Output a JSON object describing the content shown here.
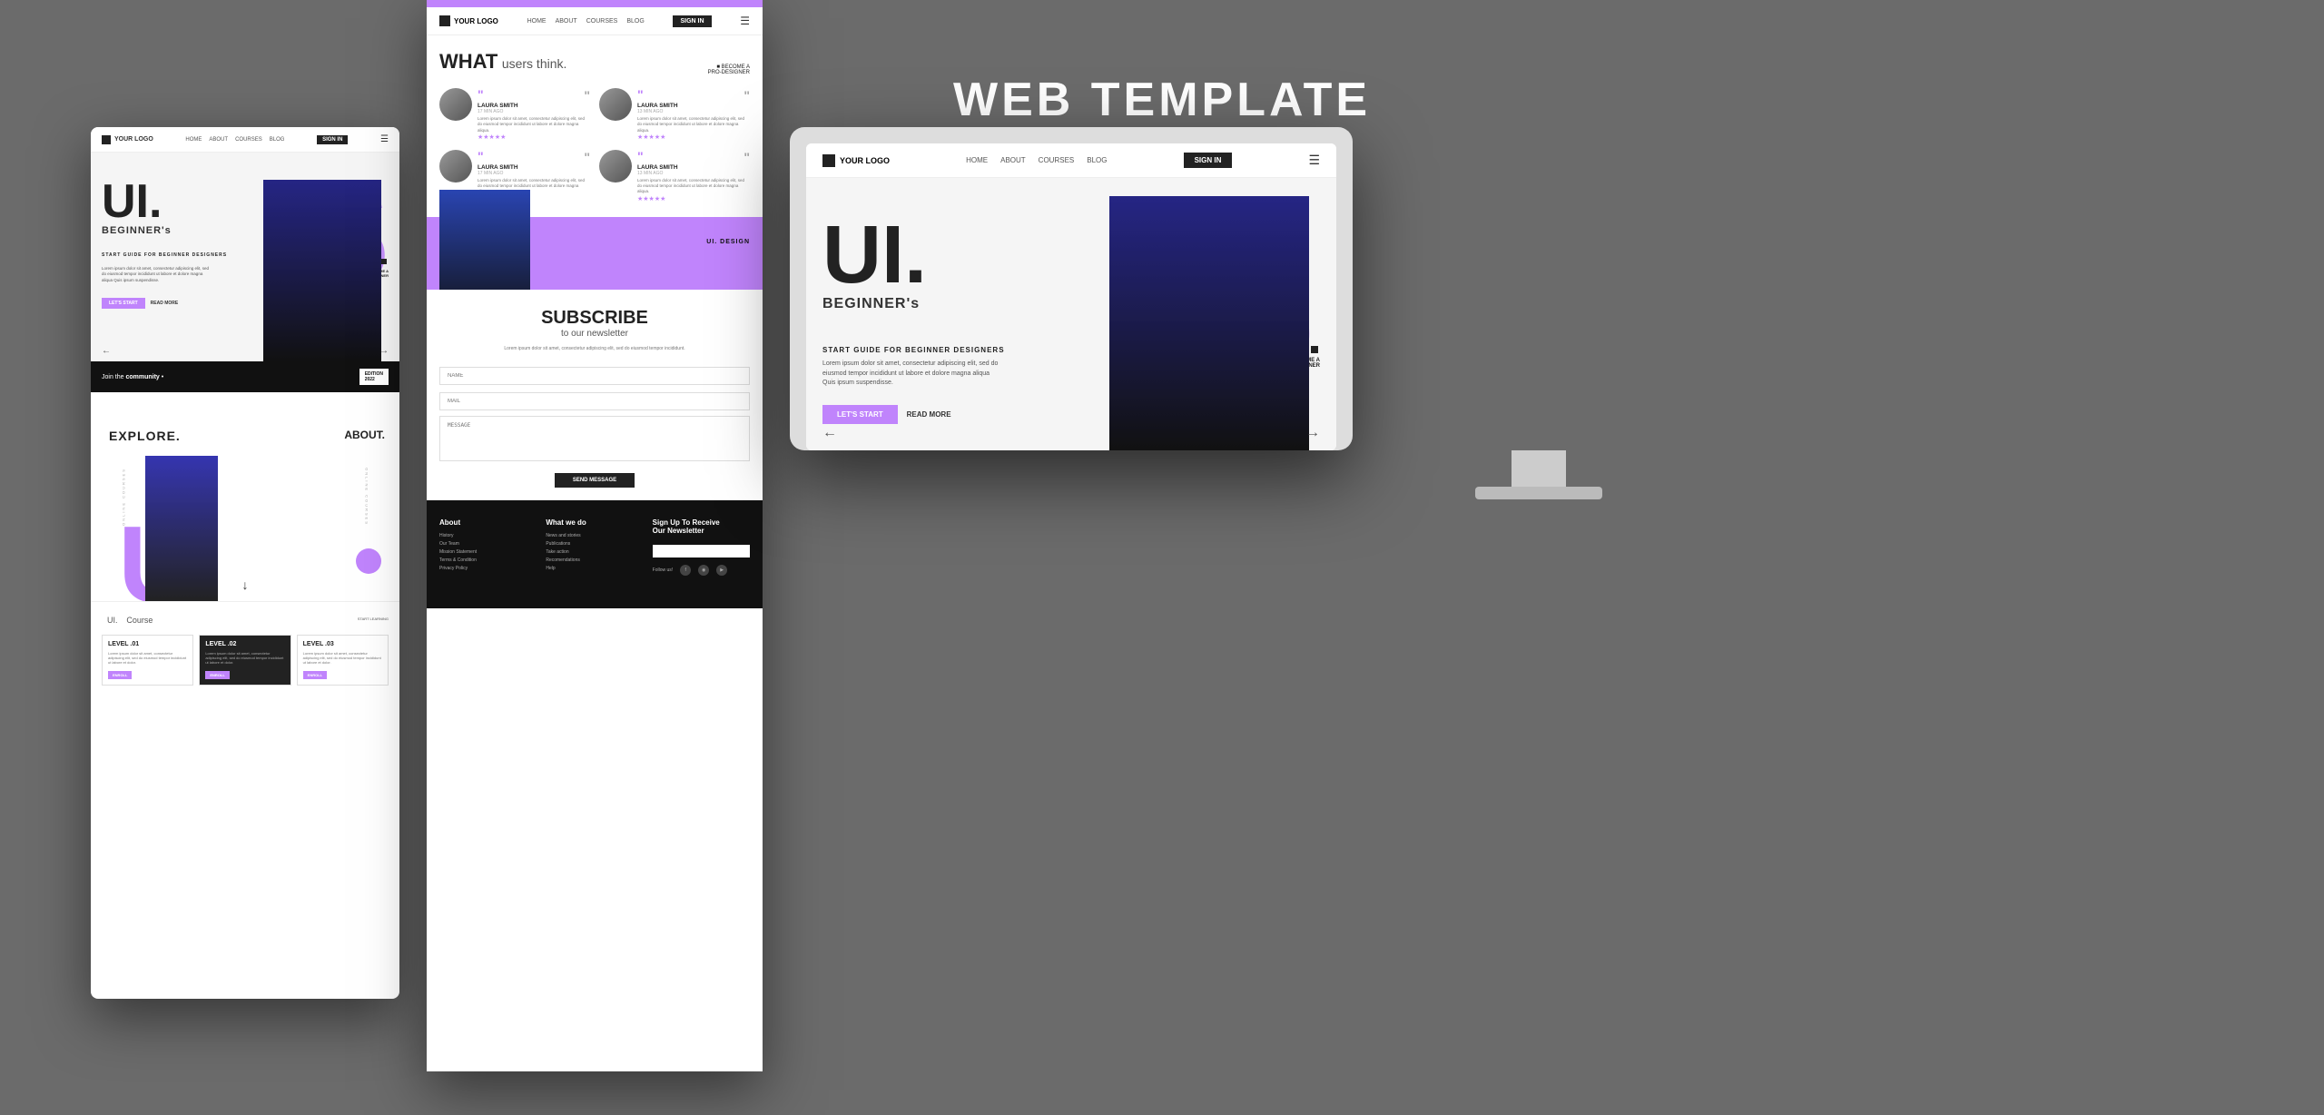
{
  "page": {
    "background_color": "#6b6b6b",
    "title": "WEB TEMPLATE",
    "subtitle": "UI DESIGN"
  },
  "mobile": {
    "logo": "YOUR LOGO",
    "nav": {
      "home": "HOME",
      "about": "ABOUT",
      "courses": "COURSES",
      "blog": "BLOG",
      "signin": "SIGN IN"
    },
    "hero": {
      "ui_label": "UI.",
      "beginner": "BEGINNER's",
      "start_guide": "START GUIDE FOR BEGINNER DESIGNERS",
      "description": "Lorem ipsum dolor sit amet, consectetur adipiscing elit, sed do eiusmod tempor incididunt ut labore et dolore magna aliqua Quis ipsum suspendisse.",
      "btn_start": "LET'S START",
      "btn_read": "READ MORE",
      "become_line1": "BECOME A",
      "become_line2": "PRO-DESIGNER"
    },
    "community": {
      "text": "Join the community",
      "edition": "EDITION",
      "year": "2022"
    },
    "explore": {
      "label": "EXPLORE.",
      "about": "ABOUT."
    },
    "courses": {
      "title": "UI.",
      "label": "Course",
      "start": "START LEARNING",
      "levels": [
        {
          "title": "LEVEL .01",
          "desc": "Lorem ipsum dolor sit amet, consectetur adipiscing elit, sed do eiusmod tempor incididunt ut labore et dolor."
        },
        {
          "title": "LEVEL .02",
          "desc": "Lorem ipsum dolor sit amet, consectetur adipiscing elit, sed do eiusmod tempor incididunt ut labore et dolor."
        },
        {
          "title": "LEVEL .03",
          "desc": "Lorem ipsum dolor sit amet, consectetur adipiscing elit, sed do eiusmod tempor incididunt ut labore et dolor."
        }
      ]
    }
  },
  "browser": {
    "logo": "YOUR LOGO",
    "nav": {
      "home": "HOME",
      "about": "ABOUT",
      "courses": "COURSES",
      "blog": "BLOG",
      "signin": "SIGN IN"
    },
    "testimonials": {
      "heading": "WHAT",
      "subheading": "users think.",
      "become": "BECOME A\nPRO-DESIGNER",
      "items": [
        {
          "name": "LAURA SMITH",
          "time": "17 MIN AGO",
          "text": "Lorem ipsum dolor sit amet, consectetur adipiscing elit, sed do eiusmod tempor incididunt ut labore et dolore magna aliqua Quis ipsum suspendisse.",
          "stars": "★★★★★"
        },
        {
          "name": "LAURA SMITH",
          "time": "13 MIN AGO",
          "text": "Lorem ipsum dolor sit amet, consectetur adipiscing elit, sed do eiusmod tempor incididunt ut labore et dolore magna aliqua Quis ipsum suspendisse.",
          "stars": "★★★★★"
        },
        {
          "name": "LAURA SMITH",
          "time": "17 MIN AGO",
          "text": "Lorem ipsum dolor sit amet, consectetur adipiscing elit, sed do eiusmod tempor incididunt ut labore et dolore magna aliqua Quis ipsum suspendisse.",
          "stars": "★★★★★"
        },
        {
          "name": "LAURA SMITH",
          "time": "13 MIN AGO",
          "text": "Lorem ipsum dolor sit amet, consectetur adipiscing elit, sed do eiusmod tempor incididunt ut labore et dolore magna aliqua Quis ipsum suspendisse.",
          "stars": "★★★★★"
        }
      ]
    },
    "subscribe": {
      "title": "SUBSCRIBE",
      "subtitle": "to our newsletter",
      "desc": "Lorem ipsum dolor sit amet, consectetur adipiscing elit, sed do eiusmod tempor incididunt.",
      "name_placeholder": "NAME",
      "mail_placeholder": "MAIL",
      "message_placeholder": "MESSAGE",
      "send_btn": "SEND MESSAGE"
    },
    "footer": {
      "about_title": "About",
      "about_links": [
        "History",
        "Our Team",
        "Mission Statement",
        "Terms & Condition",
        "Privacy Policy"
      ],
      "what_title": "What we do",
      "what_links": [
        "News and stories",
        "Publications",
        "Take action",
        "Recomendations",
        "Help"
      ],
      "newsletter_title": "Sign Up To Receive Our Newsletter",
      "follow": "Follow us!",
      "socials": [
        "f",
        "📷",
        "▶"
      ]
    }
  },
  "desktop": {
    "logo": "YOUR LOGO",
    "nav": {
      "home": "HOME",
      "about": "ABOUT",
      "courses": "COURSES",
      "blog": "BLOG",
      "signin": "SIGN IN"
    },
    "hero": {
      "ui_label": "UI.",
      "beginner": "BEGINNER's",
      "start_guide": "START GUIDE FOR BEGINNER DESIGNERS",
      "description": "Lorem ipsum dolor sit amet, consectetur adipiscing elit, sed do eiusmod tempor incididunt ut labore et dolore magna aliqua Quis ipsum suspendisse.",
      "btn_start": "LET'S START",
      "btn_read": "READ MORE",
      "become_line1": "BECOME A",
      "become_line2": "PRO-DESIGNER"
    }
  }
}
